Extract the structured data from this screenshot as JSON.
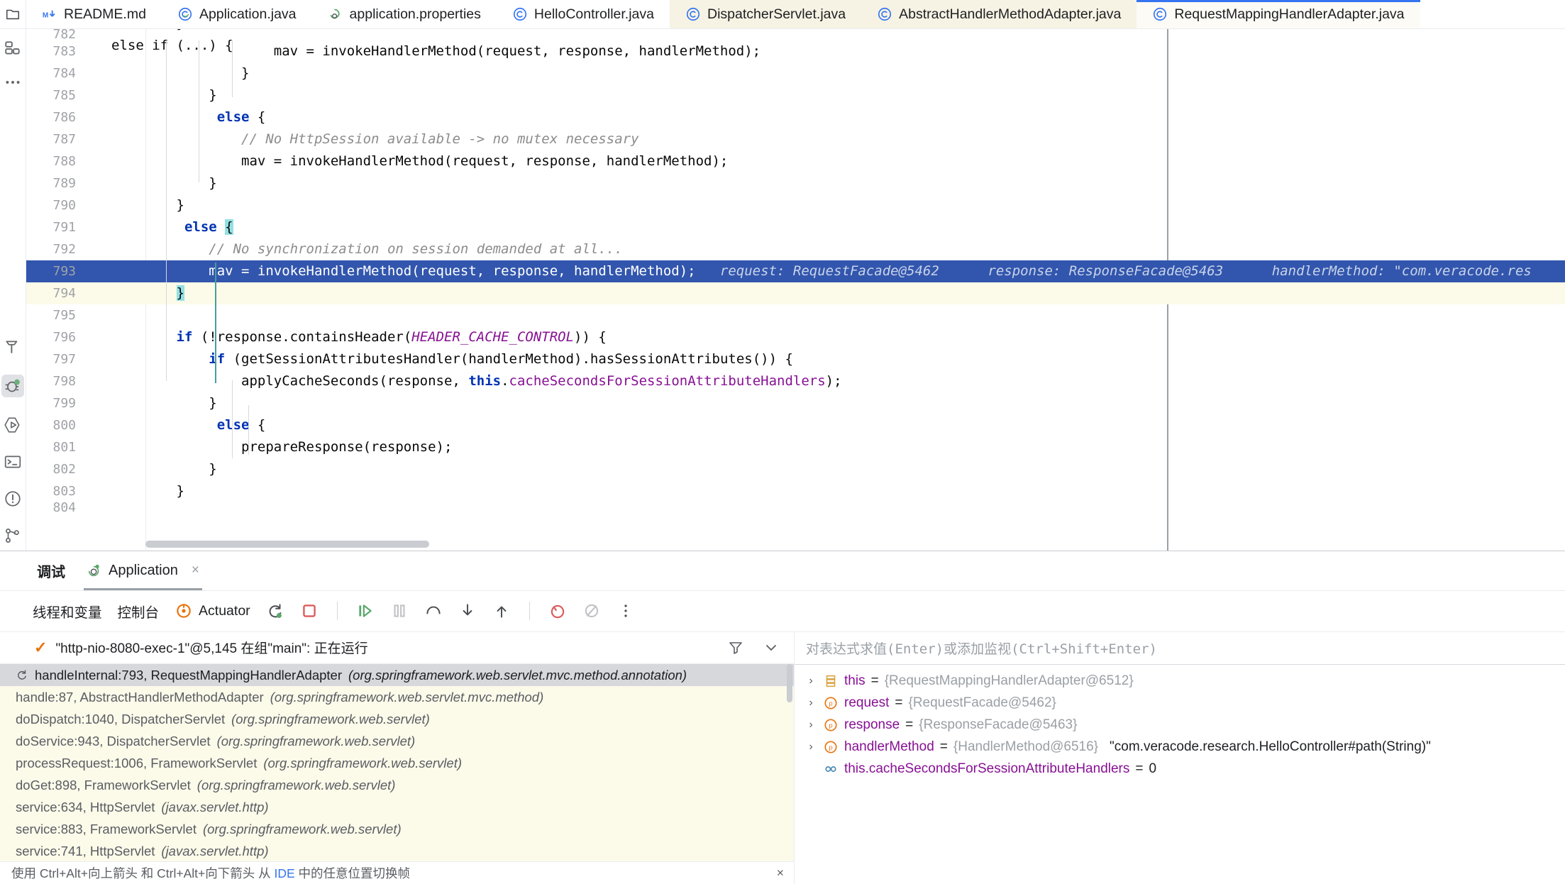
{
  "tabs": [
    {
      "label": "README.md",
      "icon": "markdown-icon",
      "state": "normal"
    },
    {
      "label": "Application.java",
      "icon": "spring-class-icon",
      "state": "normal"
    },
    {
      "label": "application.properties",
      "icon": "spring-properties-icon",
      "state": "normal"
    },
    {
      "label": "HelloController.java",
      "icon": "java-class-icon",
      "state": "normal"
    },
    {
      "label": "DispatcherServlet.java",
      "icon": "java-class-icon",
      "state": "tinted"
    },
    {
      "label": "AbstractHandlerMethodAdapter.java",
      "icon": "java-class-icon",
      "state": "tinted"
    },
    {
      "label": "RequestMappingHandlerAdapter.java",
      "icon": "java-class-icon",
      "state": "active"
    }
  ],
  "editor": {
    "lines": [
      {
        "num": "782",
        "clipped": true,
        "segments": [
          {
            "t": "        }\nelse if (...) {",
            "c": "plain"
          }
        ]
      },
      {
        "num": "783",
        "segments": [
          {
            "t": "                    mav = invokeHandlerMethod(request, response, handlerMethod);",
            "c": "plain"
          }
        ]
      },
      {
        "num": "784",
        "segments": [
          {
            "t": "                }",
            "c": "plain"
          }
        ]
      },
      {
        "num": "785",
        "segments": [
          {
            "t": "            }",
            "c": "plain"
          }
        ]
      },
      {
        "num": "786",
        "segments": [
          {
            "t": "             ",
            "c": "plain"
          },
          {
            "t": "else",
            "c": "kw"
          },
          {
            "t": " {",
            "c": "plain"
          }
        ]
      },
      {
        "num": "787",
        "segments": [
          {
            "t": "                ",
            "c": "plain"
          },
          {
            "t": "// No HttpSession available -> no mutex necessary",
            "c": "cm"
          }
        ]
      },
      {
        "num": "788",
        "segments": [
          {
            "t": "                mav = invokeHandlerMethod(request, response, handlerMethod);",
            "c": "plain"
          }
        ]
      },
      {
        "num": "789",
        "segments": [
          {
            "t": "            }",
            "c": "plain"
          }
        ]
      },
      {
        "num": "790",
        "segments": [
          {
            "t": "        }",
            "c": "plain"
          }
        ]
      },
      {
        "num": "791",
        "segments": [
          {
            "t": "         ",
            "c": "plain"
          },
          {
            "t": "else",
            "c": "kw"
          },
          {
            "t": " ",
            "c": "plain"
          },
          {
            "t": "{",
            "c": "brace"
          }
        ]
      },
      {
        "num": "792",
        "segments": [
          {
            "t": "            ",
            "c": "plain"
          },
          {
            "t": "// No synchronization on session demanded at all...",
            "c": "cm"
          }
        ]
      },
      {
        "num": "793",
        "highlight": "blue",
        "segments": [
          {
            "t": "            mav = invokeHandlerMethod(request, response, handlerMethod);",
            "c": "plain"
          },
          {
            "t": "   request: RequestFacade@5462",
            "c": "hint"
          },
          {
            "t": "      response: ResponseFacade@5463",
            "c": "hint"
          },
          {
            "t": "      handlerMethod: \"com.veracode.res",
            "c": "hint"
          }
        ]
      },
      {
        "num": "794",
        "highlight": "cream",
        "segments": [
          {
            "t": "        ",
            "c": "plain"
          },
          {
            "t": "}",
            "c": "brace"
          }
        ]
      },
      {
        "num": "795",
        "segments": [
          {
            "t": "",
            "c": "plain"
          }
        ]
      },
      {
        "num": "796",
        "segments": [
          {
            "t": "        ",
            "c": "plain"
          },
          {
            "t": "if",
            "c": "kw"
          },
          {
            "t": " (!response.containsHeader(",
            "c": "plain"
          },
          {
            "t": "HEADER_CACHE_CONTROL",
            "c": "const"
          },
          {
            "t": ")) {",
            "c": "plain"
          }
        ]
      },
      {
        "num": "797",
        "segments": [
          {
            "t": "            ",
            "c": "plain"
          },
          {
            "t": "if",
            "c": "kw"
          },
          {
            "t": " (getSessionAttributesHandler(handlerMethod).hasSessionAttributes()) {",
            "c": "plain"
          }
        ]
      },
      {
        "num": "798",
        "segments": [
          {
            "t": "                applyCacheSeconds(response, ",
            "c": "plain"
          },
          {
            "t": "this",
            "c": "this"
          },
          {
            "t": ".",
            "c": "plain"
          },
          {
            "t": "cacheSecondsForSessionAttributeHandlers",
            "c": "field"
          },
          {
            "t": ");",
            "c": "plain"
          }
        ]
      },
      {
        "num": "799",
        "segments": [
          {
            "t": "            }",
            "c": "plain"
          }
        ]
      },
      {
        "num": "800",
        "segments": [
          {
            "t": "             ",
            "c": "plain"
          },
          {
            "t": "else",
            "c": "kw"
          },
          {
            "t": " {",
            "c": "plain"
          }
        ]
      },
      {
        "num": "801",
        "segments": [
          {
            "t": "                prepareResponse(response);",
            "c": "plain"
          }
        ]
      },
      {
        "num": "802",
        "segments": [
          {
            "t": "            }",
            "c": "plain"
          }
        ]
      },
      {
        "num": "803",
        "segments": [
          {
            "t": "        }",
            "c": "plain"
          }
        ]
      },
      {
        "num": "804",
        "clipped": true,
        "segments": [
          {
            "t": "",
            "c": "plain"
          }
        ]
      }
    ]
  },
  "debug": {
    "title": "调试",
    "run_tab_label": "Application",
    "run_tab_close": "×",
    "toolbar": {
      "threads_and_variables": "线程和变量",
      "console": "控制台",
      "actuator": "Actuator",
      "icons": [
        "rerun-debug-icon",
        "stop-icon",
        "resume-icon",
        "pause-icon",
        "step-over-icon",
        "step-into-icon",
        "step-out-icon",
        "view-breakpoints-icon",
        "mute-breakpoints-icon",
        "more-options-icon"
      ]
    },
    "thread": {
      "check": "✓",
      "label": "\"http-nio-8080-exec-1\"@5,145 在组\"main\": 正在运行",
      "filter_icon": "filter-icon",
      "dropdown_icon": "chevron-down-icon"
    },
    "frames": [
      {
        "text": "handleInternal:793, RequestMappingHandlerAdapter",
        "pkg": "(org.springframework.web.servlet.mvc.method.annotation)",
        "selected": true,
        "icon": "current-frame-icon"
      },
      {
        "text": "handle:87, AbstractHandlerMethodAdapter",
        "pkg": "(org.springframework.web.servlet.mvc.method)",
        "selected": false
      },
      {
        "text": "doDispatch:1040, DispatcherServlet",
        "pkg": "(org.springframework.web.servlet)",
        "selected": false
      },
      {
        "text": "doService:943, DispatcherServlet",
        "pkg": "(org.springframework.web.servlet)",
        "selected": false
      },
      {
        "text": "processRequest:1006, FrameworkServlet",
        "pkg": "(org.springframework.web.servlet)",
        "selected": false
      },
      {
        "text": "doGet:898, FrameworkServlet",
        "pkg": "(org.springframework.web.servlet)",
        "selected": false
      },
      {
        "text": "service:634, HttpServlet",
        "pkg": "(javax.servlet.http)",
        "selected": false
      },
      {
        "text": "service:883, FrameworkServlet",
        "pkg": "(org.springframework.web.servlet)",
        "selected": false
      },
      {
        "text": "service:741, HttpServlet",
        "pkg": "(javax.servlet.http)",
        "selected": false
      }
    ],
    "hint": {
      "text": "使用 Ctrl+Alt+向上箭头 和 Ctrl+Alt+向下箭头 从 IDE 中的任意位置切换帧",
      "link_word": "IDE",
      "close": "×"
    },
    "watch_placeholder": "对表达式求值(Enter)或添加监视(Ctrl+Shift+Enter)",
    "variables": [
      {
        "chevron": "›",
        "icon": "object-icon",
        "name": "this",
        "eq": " = ",
        "value": "{RequestMappingHandlerAdapter@6512}",
        "str": ""
      },
      {
        "chevron": "›",
        "icon": "parameter-icon",
        "name": "request",
        "eq": " = ",
        "value": "{RequestFacade@5462}",
        "str": ""
      },
      {
        "chevron": "›",
        "icon": "parameter-icon",
        "name": "response",
        "eq": " = ",
        "value": "{ResponseFacade@5463}",
        "str": ""
      },
      {
        "chevron": "›",
        "icon": "parameter-icon",
        "name": "handlerMethod",
        "eq": " = ",
        "value": "{HandlerMethod@6516}",
        "str": "\"com.veracode.research.HelloController#path(String)\""
      },
      {
        "chevron": "",
        "icon": "primitive-icon",
        "name": "this.cacheSecondsForSessionAttributeHandlers",
        "eq": " = ",
        "value": "",
        "str": "0"
      }
    ]
  },
  "sidebar": {
    "top": [
      "project-icon",
      "structure-icon",
      "more-tools-icon"
    ],
    "bottom": [
      "build-icon",
      "debug-icon",
      "run-icon",
      "terminal-icon",
      "problems-icon",
      "git-icon"
    ]
  },
  "colors": {
    "accent": "#3574f0",
    "selection_blue": "#3256ad",
    "cream": "#fcfae9",
    "tab_tint": "#f6f3e4",
    "keyword": "#0033b3",
    "field": "#871094",
    "comment": "#8c8c8c"
  }
}
